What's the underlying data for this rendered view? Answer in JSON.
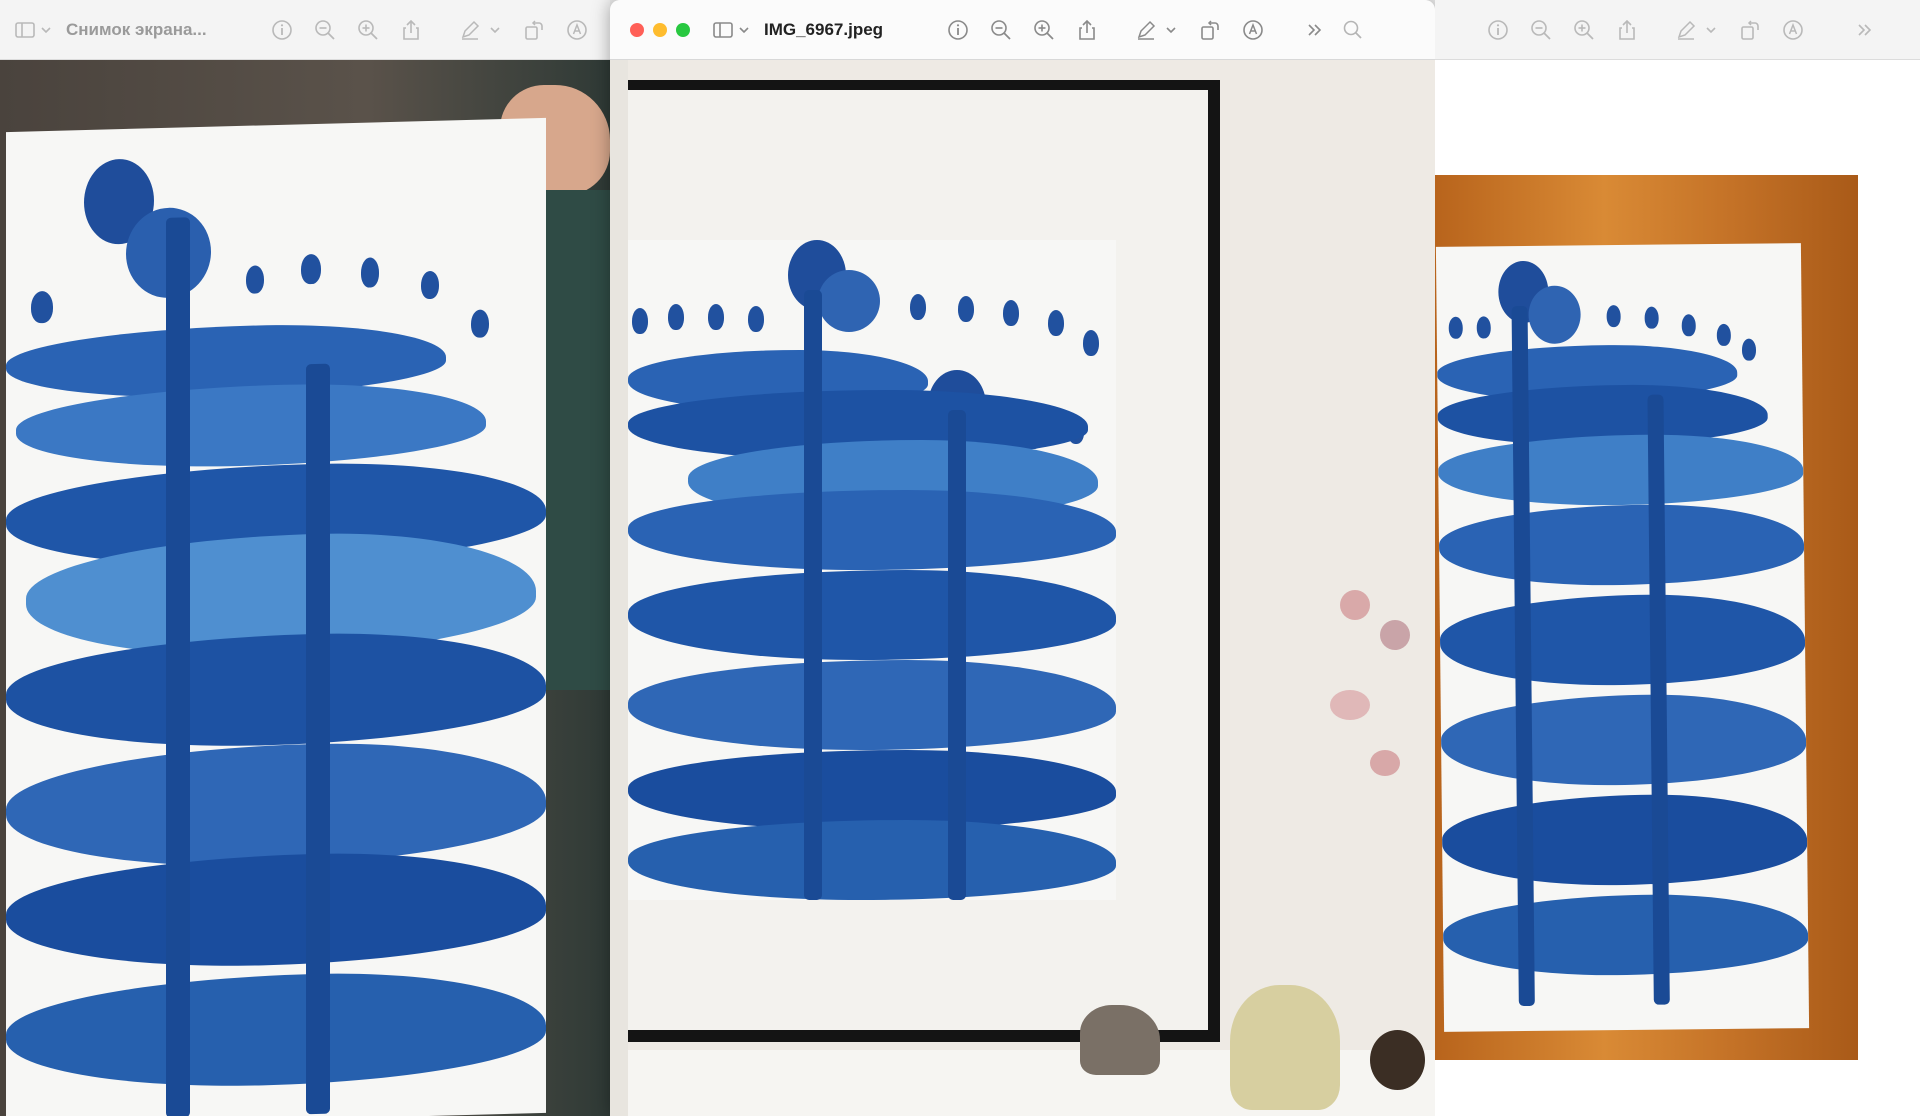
{
  "windows": {
    "left": {
      "title": "Снимок экрана..."
    },
    "center": {
      "title": "IMG_6967.jpeg"
    },
    "right": {
      "title": ""
    }
  },
  "icons": [
    "sidebar-icon",
    "chevron-down-icon",
    "info-icon",
    "zoom-out-icon",
    "zoom-in-icon",
    "share-icon",
    "highlight-pen-icon",
    "rotate-icon",
    "markup-icon",
    "more-icon",
    "search-icon"
  ],
  "colors": {
    "traffic_close": "#ff5f57",
    "traffic_minimize": "#febc2e",
    "traffic_zoom": "#28c840",
    "ink_dark": "#123f8f",
    "ink_mid": "#2a63b4",
    "ink_light": "#4f8fd0"
  }
}
